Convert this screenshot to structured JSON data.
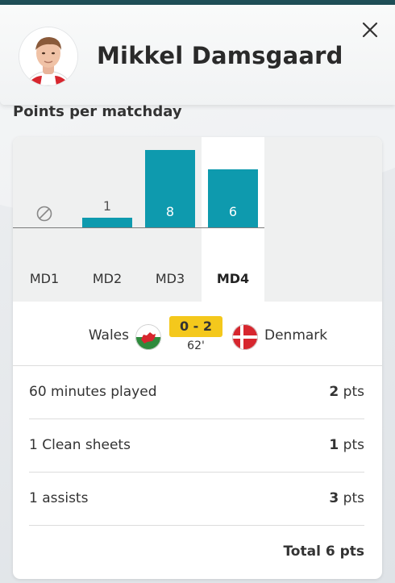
{
  "player": {
    "name": "Mikkel Damsgaard"
  },
  "section": {
    "title": "Points per matchday"
  },
  "close": {
    "icon": "close-icon"
  },
  "chart_data": {
    "type": "bar",
    "categories": [
      "MD1",
      "MD2",
      "MD3",
      "MD4"
    ],
    "values": [
      null,
      1,
      8,
      6
    ],
    "not_played": [
      "MD1"
    ],
    "selected": "MD4",
    "bar_color": "#0e9aae",
    "value_labels": [
      "",
      "1",
      "8",
      "6"
    ]
  },
  "match": {
    "home_team": "Wales",
    "away_team": "Denmark",
    "score": "0 - 2",
    "minute": "62'",
    "score_color": "#f4c81c"
  },
  "stats": [
    {
      "label": "60 minutes played",
      "points": "2",
      "unit": "pts"
    },
    {
      "label": "1 Clean sheets",
      "points": "1",
      "unit": "pts"
    },
    {
      "label": "1 assists",
      "points": "3",
      "unit": "pts"
    }
  ],
  "total": {
    "text": "Total 6 pts"
  }
}
